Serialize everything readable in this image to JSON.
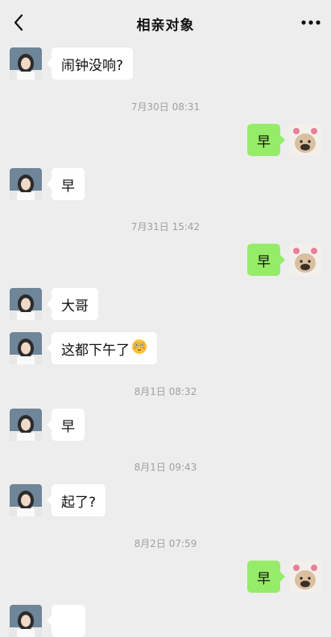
{
  "header": {
    "title": "相亲对象",
    "back_icon": "chevron-left-icon",
    "more_icon": "ellipsis-icon"
  },
  "colors": {
    "background": "#ededed",
    "incoming_bubble": "#ffffff",
    "outgoing_bubble": "#95ec69",
    "timestamp": "#a0a0a0"
  },
  "chat": {
    "msg1": "闹钟没响?",
    "time1": "7月30日 08:31",
    "msg2": "早",
    "msg3": "早",
    "time2": "7月31日 15:42",
    "msg4": "早",
    "msg5": "大哥",
    "msg6": "这都下午了",
    "msg6_emoji": "flushed-face-icon",
    "time3": "8月1日 08:32",
    "msg7": "早",
    "time4": "8月1日 09:43",
    "msg8": "起了?",
    "time5": "8月2日 07:59",
    "msg9": "早"
  }
}
